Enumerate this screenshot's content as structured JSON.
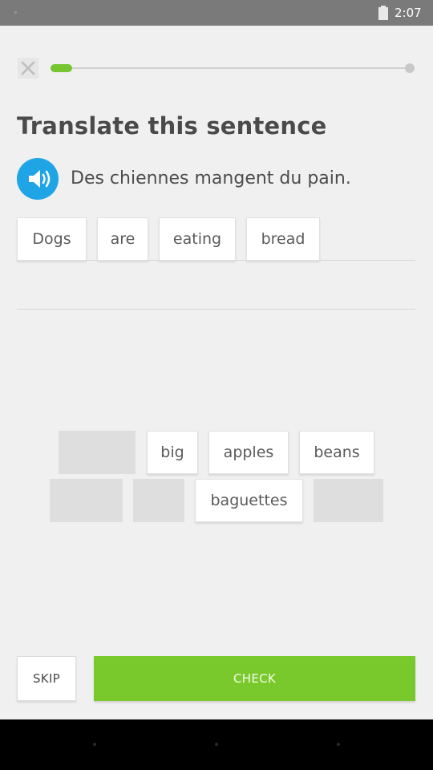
{
  "status_bar": {
    "time": "2:07",
    "battery_icon": "battery-icon"
  },
  "header": {
    "close_icon": "close-icon",
    "progress": 0.06,
    "progress_color": "#77c531"
  },
  "prompt": {
    "title": "Translate this sentence",
    "sentence": "Des chiennes mangent du pain.",
    "speaker_icon": "speaker-icon",
    "speaker_color": "#1fa5e6"
  },
  "answer": {
    "tiles": [
      "Dogs",
      "are",
      "eating",
      "bread"
    ]
  },
  "word_bank": {
    "row1": [
      "big",
      "apples",
      "beans"
    ],
    "row2": [
      "baguettes"
    ]
  },
  "actions": {
    "skip_label": "SKIP",
    "check_label": "CHECK",
    "check_color": "#79c92d"
  }
}
